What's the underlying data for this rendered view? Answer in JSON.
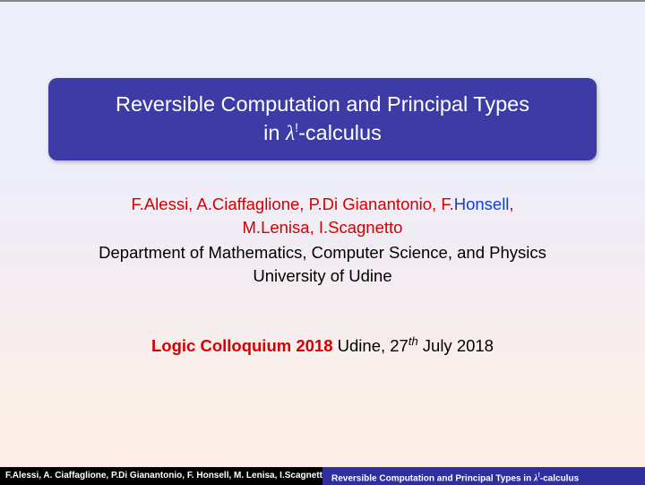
{
  "title": {
    "line1": "Reversible Computation and Principal Types",
    "line2_prefix": "in ",
    "line2_lambda": "λ",
    "line2_sup": "!",
    "line2_suffix": "-calculus"
  },
  "authors": {
    "red1": "F.Alessi, A.Ciaffaglione, P.Di Gianantonio, ",
    "blue_initial": "F.",
    "blue_name": "Honsell",
    "comma": ",",
    "red2": "M.Lenisa, I.Scagnetto"
  },
  "dept": {
    "line1": "Department of Mathematics, Computer Science, and Physics",
    "line2": "University of Udine"
  },
  "colloquium": {
    "name": "Logic Colloquium 2018",
    "rest_prefix": " Udine, 27",
    "sup": "th",
    "rest_suffix": " July 2018"
  },
  "footer": {
    "left": "F.Alessi, A. Ciaffaglione, P.Di Gianantonio, F. Honsell, M. Lenisa, I.Scagnetto",
    "right_prefix": "Reversible Computation and Principal Types in ",
    "right_lambda": "λ",
    "right_sup": "!",
    "right_suffix": "-calculus"
  }
}
